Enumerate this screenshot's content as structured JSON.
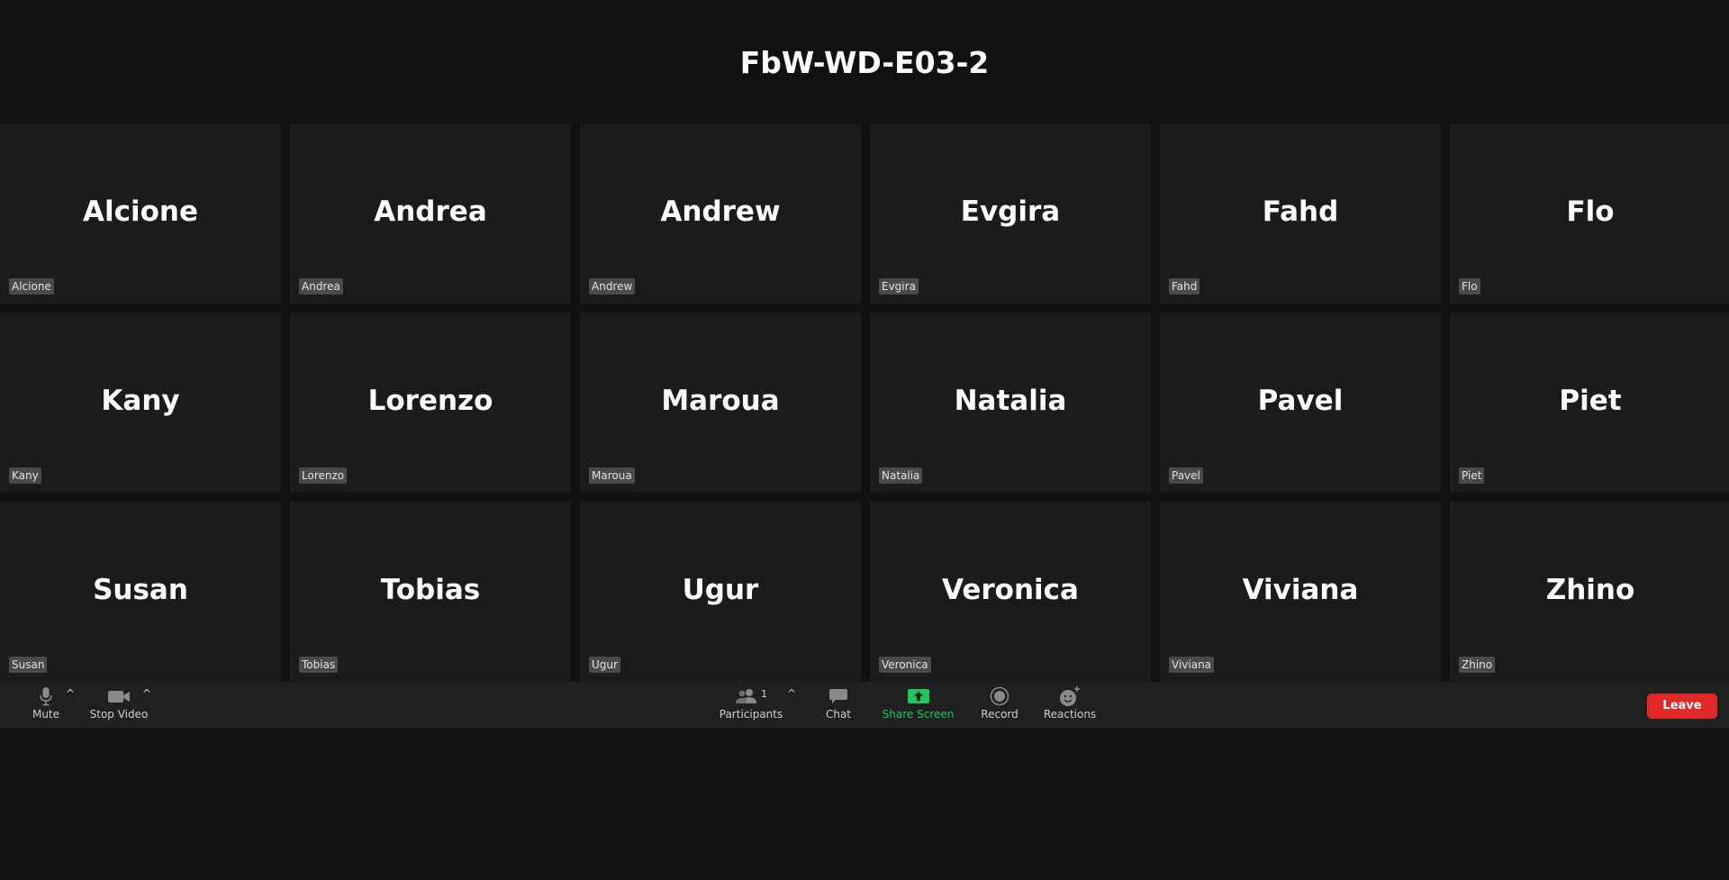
{
  "meeting": {
    "title": "FbW-WD-E03-2"
  },
  "participants": [
    {
      "display": "Alcione",
      "tag": "Alcione"
    },
    {
      "display": "Andrea",
      "tag": "Andrea"
    },
    {
      "display": "Andrew",
      "tag": "Andrew"
    },
    {
      "display": "Evgira",
      "tag": "Evgira"
    },
    {
      "display": "Fahd",
      "tag": "Fahd"
    },
    {
      "display": "Flo",
      "tag": "Flo"
    },
    {
      "display": "Kany",
      "tag": "Kany"
    },
    {
      "display": "Lorenzo",
      "tag": "Lorenzo"
    },
    {
      "display": "Maroua",
      "tag": "Maroua"
    },
    {
      "display": "Natalia",
      "tag": "Natalia"
    },
    {
      "display": "Pavel",
      "tag": "Pavel"
    },
    {
      "display": "Piet",
      "tag": "Piet"
    },
    {
      "display": "Susan",
      "tag": "Susan"
    },
    {
      "display": "Tobias",
      "tag": "Tobias"
    },
    {
      "display": "Ugur",
      "tag": "Ugur"
    },
    {
      "display": "Veronica",
      "tag": "Veronica"
    },
    {
      "display": "Viviana",
      "tag": "Viviana"
    },
    {
      "display": "Zhino",
      "tag": "Zhino"
    }
  ],
  "toolbar": {
    "mute_label": "Mute",
    "mute_icon": "microphone-icon",
    "video_label": "Stop Video",
    "video_icon": "video-camera-icon",
    "caret_symbol": "^",
    "participants_label": "Participants",
    "participants_icon": "participants-icon",
    "participants_count": "1",
    "chat_label": "Chat",
    "chat_icon": "chat-icon",
    "share_label": "Share Screen",
    "share_icon": "share-screen-icon",
    "record_label": "Record",
    "record_icon": "record-icon",
    "reactions_label": "Reactions",
    "reactions_icon": "reactions-icon",
    "leave_label": "Leave"
  },
  "colors": {
    "background": "#111111",
    "tile": "#1b1b1b",
    "toolbar": "#1f2021",
    "share_accent": "#22c55e",
    "leave": "#e02828"
  }
}
